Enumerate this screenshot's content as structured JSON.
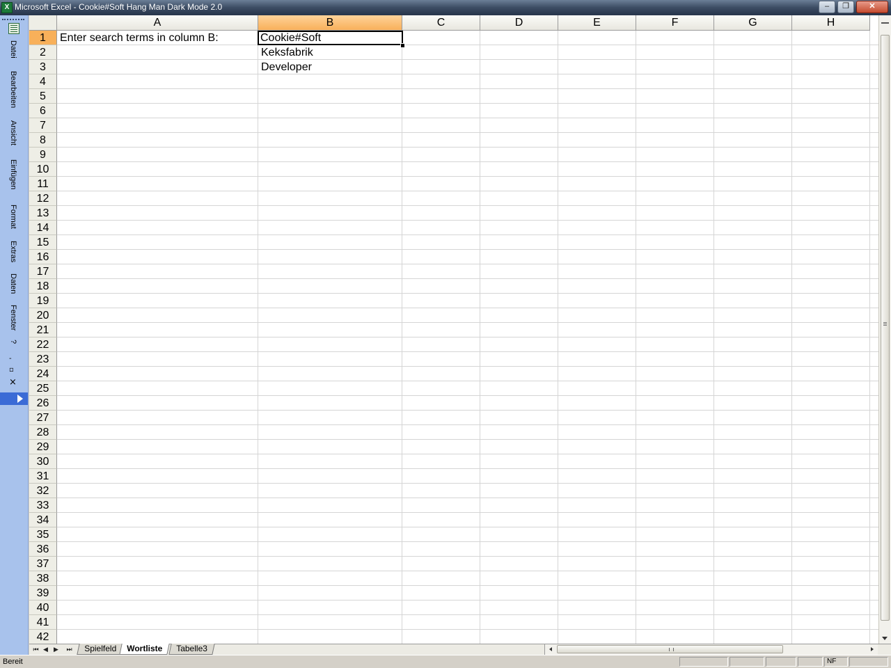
{
  "window": {
    "app_icon": "excel-icon",
    "title": "Microsoft Excel - Cookie#Soft Hang Man Dark Mode 2.0",
    "minimize_glyph": "–",
    "restore_glyph": "❐",
    "close_glyph": "✕"
  },
  "menu": {
    "items": [
      "Datei",
      "Bearbeiten",
      "Ansicht",
      "Einfügen",
      "Format",
      "Extras",
      "Daten",
      "Fenster",
      "?"
    ],
    "minimize_glyph": "-",
    "restore_glyph": "▫",
    "close_glyph": "×"
  },
  "sheet": {
    "columns": [
      "A",
      "B",
      "C",
      "D",
      "E",
      "F",
      "G",
      "H"
    ],
    "selected_column": "B",
    "selected_row": 1,
    "rows": [
      "1",
      "2",
      "3",
      "4",
      "5",
      "6",
      "7",
      "8",
      "9",
      "10",
      "11",
      "12",
      "13",
      "14",
      "15",
      "16",
      "17",
      "18",
      "19",
      "20",
      "21",
      "22",
      "23",
      "24",
      "25",
      "26",
      "27",
      "28",
      "29",
      "30",
      "31",
      "32",
      "33",
      "34",
      "35",
      "36",
      "37",
      "38",
      "39",
      "40",
      "41",
      "42"
    ],
    "cells": {
      "A1": "Enter search terms in column B:",
      "B1": "Cookie#Soft",
      "B2": "Keksfabrik",
      "B3": "Developer"
    }
  },
  "tabs": {
    "nav": [
      "⏮",
      "◀",
      "▶",
      "⏭"
    ],
    "items": [
      "Spielfeld",
      "Wortliste",
      "Tabelle3"
    ],
    "active": "Wortliste"
  },
  "status": {
    "ready_text": "Bereit",
    "numlock": "NF"
  }
}
